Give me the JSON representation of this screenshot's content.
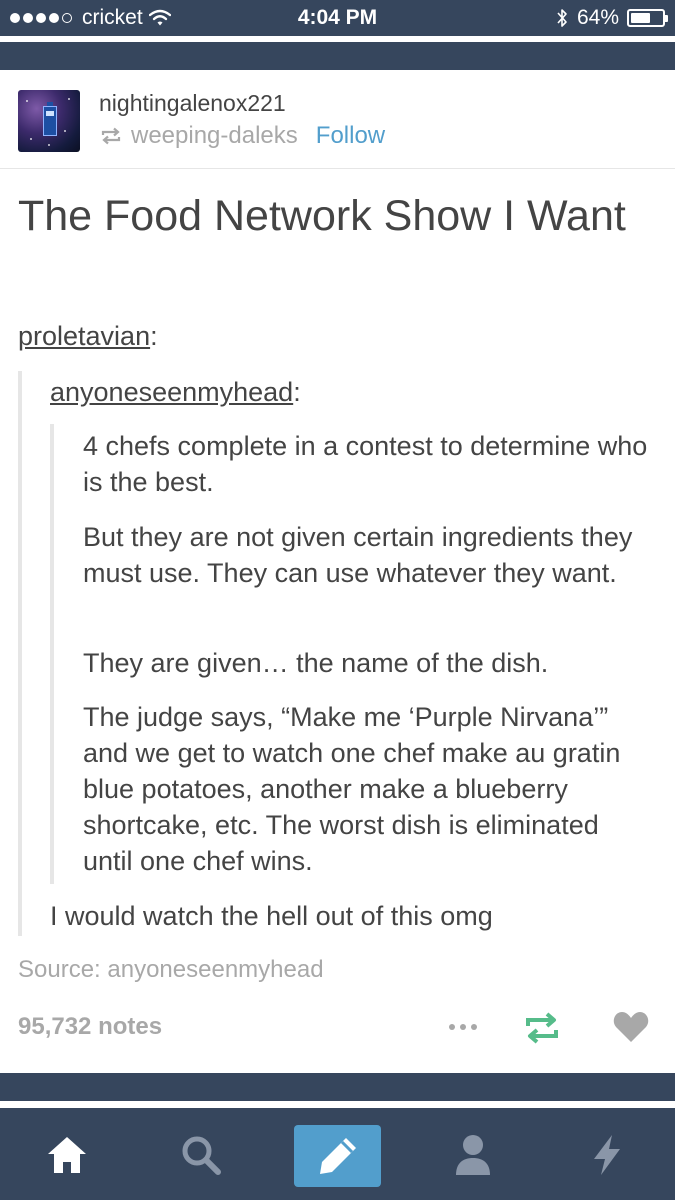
{
  "status_bar": {
    "carrier": "cricket",
    "time": "4:04 PM",
    "battery": "64%",
    "battery_level": 0.64,
    "signal_bars": 4
  },
  "post": {
    "username": "nightingalenox221",
    "reblogged_from": "weeping-daleks",
    "follow_label": "Follow",
    "title": "The Food Network Show I Want",
    "level1_user": "proletavian",
    "level2_user": "anyoneseenmyhead",
    "paragraphs": [
      "4 chefs complete in a contest to determine who is the best.",
      "But they are not given certain ingredients they must use. They can use whatever they want.",
      "They are given… the name of the dish.",
      "The judge says, “Make me ‘Purple Nirvana’” and we get to watch one chef make au gratin blue potatoes, another make a blueberry shortcake, etc. The worst dish is eliminated until one chef wins."
    ],
    "reply": "I would watch the hell out of this omg",
    "source": "Source: anyoneseenmyhead",
    "notes": "95,732 notes"
  },
  "colors": {
    "tumblr_navy": "#36465d",
    "accent_blue": "#529ecc",
    "reblog_green": "#56bc8a",
    "muted_gray": "#a8a8a8",
    "text": "#444444"
  },
  "icons": {
    "status": [
      "wifi-icon",
      "bluetooth-icon",
      "battery-icon"
    ],
    "post": [
      "reblog-small-icon",
      "more-icon",
      "reblog-icon",
      "heart-icon"
    ],
    "tabs": [
      "home-icon",
      "search-icon",
      "compose-pencil-icon",
      "account-icon",
      "activity-lightning-icon"
    ]
  }
}
